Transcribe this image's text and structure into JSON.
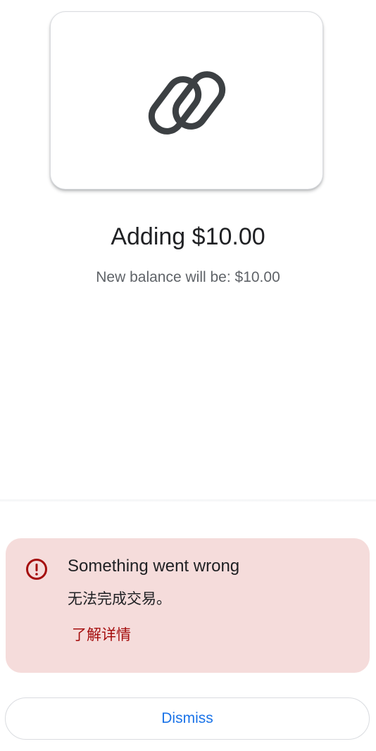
{
  "card": {
    "logo_icon": "linked-rounded-rectangles-icon",
    "logo_color": "#3c4043"
  },
  "transaction": {
    "title": "Adding $10.00",
    "balance_text": "New balance will be: $10.00"
  },
  "error": {
    "icon": "error-exclamation-circle-icon",
    "icon_color": "#a50e0e",
    "background_color": "#f5dcdb",
    "title": "Something went wrong",
    "message": "无法完成交易。",
    "link_label": "了解详情"
  },
  "actions": {
    "dismiss_label": "Dismiss",
    "accent_color": "#1a73e8"
  }
}
